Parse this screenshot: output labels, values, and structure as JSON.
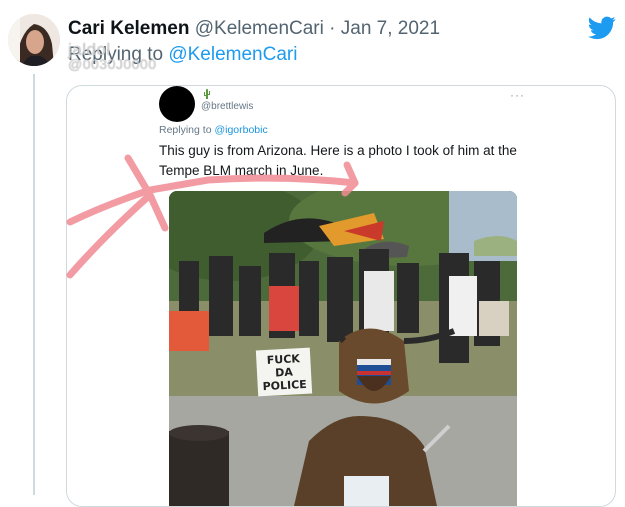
{
  "tweet": {
    "display_name": "Cari Kelemen",
    "handle": "@KelemenCari",
    "separator": "·",
    "date": "Jan 7, 2021",
    "replying_prefix": "Replying to",
    "replying_to": "@KelemenCari",
    "watermark_line1": "jaldol",
    "watermark_line2": "@0030J0000",
    "brand_icon": "twitter-bird-icon",
    "brand_color": "#1d9bf0"
  },
  "quoted_tweet": {
    "cactus_icon": "cactus-icon",
    "handle": "@brettlewis",
    "more": "···",
    "replying_prefix": "Replying to",
    "replying_to": "@igorbobic",
    "text": "This guy is from Arizona. Here is a photo I took of him at the Tempe BLM march in June.",
    "photo_sign_text": "FUCK DA POLICE"
  },
  "annotation": {
    "arrow_color": "#f08a94",
    "arrow_icon": "hand-drawn-arrow-icon"
  }
}
